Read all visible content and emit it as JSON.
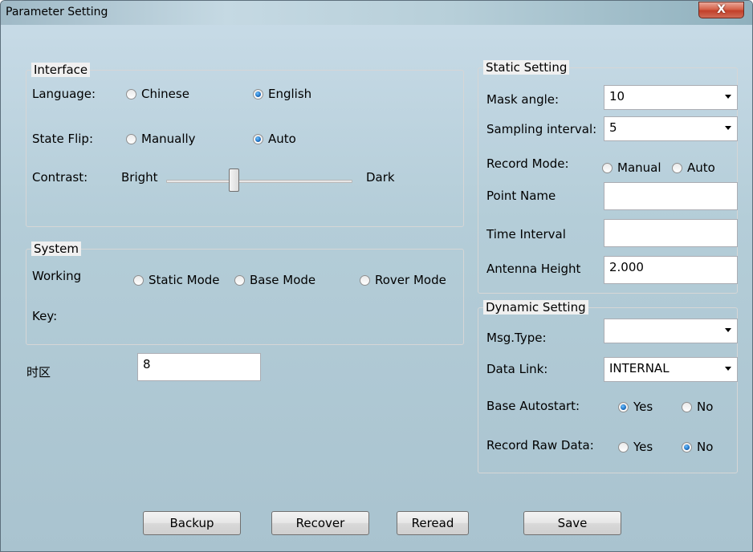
{
  "window": {
    "title": "Parameter Setting",
    "close_label": "X"
  },
  "interface": {
    "legend": "Interface",
    "language_label": "Language:",
    "language_options": [
      "Chinese",
      "English"
    ],
    "language_selected": "English",
    "state_flip_label": "State Flip:",
    "state_flip_options": [
      "Manually",
      "Auto"
    ],
    "state_flip_selected": "Auto",
    "contrast_label": "Contrast:",
    "contrast_min_label": "Bright",
    "contrast_max_label": "Dark",
    "contrast_level": 0.36
  },
  "system": {
    "legend": "System",
    "working_label": "Working",
    "working_options": [
      "Static Mode",
      "Base Mode",
      "Rover Mode"
    ],
    "working_selected": "",
    "key_label": "Key:"
  },
  "timezone": {
    "label": "时区",
    "value": "8"
  },
  "static": {
    "legend": "Static Setting",
    "mask_angle_label": "Mask angle:",
    "mask_angle_value": "10",
    "sampling_label": "Sampling interval:",
    "sampling_value": "5",
    "record_mode_label": "Record Mode:",
    "record_mode_options": [
      "Manual",
      "Auto"
    ],
    "record_mode_selected": "",
    "point_name_label": "Point Name",
    "point_name_value": "",
    "time_interval_label": "Time Interval",
    "time_interval_value": "",
    "antenna_label": "Antenna Height",
    "antenna_value": "2.000"
  },
  "dynamic": {
    "legend": "Dynamic Setting",
    "msg_type_label": "Msg.Type:",
    "msg_type_value": "",
    "data_link_label": "Data Link:",
    "data_link_value": "INTERNAL",
    "base_autostart_label": "Base Autostart:",
    "base_autostart_options": [
      "Yes",
      "No"
    ],
    "base_autostart_selected": "Yes",
    "record_raw_label": "Record Raw Data:",
    "record_raw_options": [
      "Yes",
      "No"
    ],
    "record_raw_selected": "No"
  },
  "buttons": {
    "backup": "Backup",
    "recover": "Recover",
    "reread": "Reread",
    "save": "Save"
  },
  "icons": {
    "close": "close-icon",
    "dropdown": "chevron-down-icon"
  }
}
